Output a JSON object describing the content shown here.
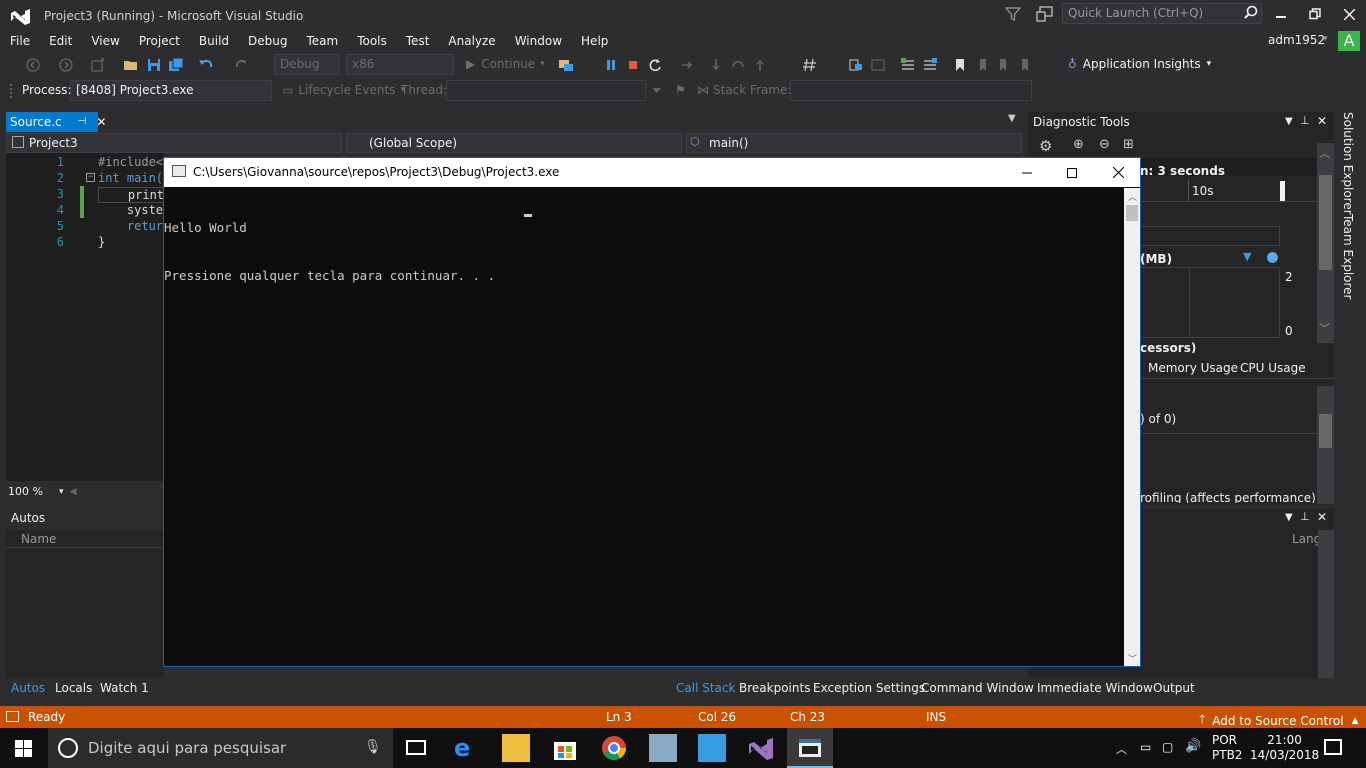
{
  "window": {
    "title": "Project3 (Running) - Microsoft Visual Studio",
    "quick_launch_placeholder": "Quick Launch (Ctrl+Q)"
  },
  "menu": [
    "File",
    "Edit",
    "View",
    "Project",
    "Build",
    "Debug",
    "Team",
    "Tools",
    "Test",
    "Analyze",
    "Window",
    "Help"
  ],
  "user": {
    "name": "adm1952",
    "avatar_letter": "A"
  },
  "toolbar": {
    "config": "Debug",
    "platform": "x86",
    "continue_label": "Continue",
    "app_insights_label": "Application Insights"
  },
  "debug_location": {
    "process_label": "Process:",
    "process_value": "[8408] Project3.exe",
    "lifecycle_label": "Lifecycle Events",
    "thread_label": "Thread:",
    "stack_frame_label": "Stack Frame:"
  },
  "editor": {
    "tab_label": "Source.c",
    "project_combo": "Project3",
    "scope_combo": "(Global Scope)",
    "member_combo": "main()",
    "lines": [
      {
        "num": "1",
        "text": "#include<"
      },
      {
        "num": "2",
        "text": "int main("
      },
      {
        "num": "3",
        "text": "    print"
      },
      {
        "num": "4",
        "text": "    syste"
      },
      {
        "num": "5",
        "text": "    retur"
      },
      {
        "num": "6",
        "text": "}"
      }
    ],
    "zoom": "100 %"
  },
  "autos": {
    "title": "Autos",
    "name_column": "Name",
    "lang_column": "Lang"
  },
  "diagnostic_tools": {
    "title": "Diagnostic Tools",
    "session_fragment": "n: 3 seconds",
    "tick_10s": "10s",
    "memory_fragment": "(MB)",
    "axis_top": "2",
    "axis_bottom": "0",
    "processors_fragment": "cessors)",
    "tab_memory": "Memory Usage",
    "tab_cpu": "CPU Usage",
    "events_fragment": ") of 0)",
    "profiling_fragment": "rofiling (affects performance)"
  },
  "side_tabs": {
    "solution_explorer": "Solution Explorer",
    "team_explorer": "Team Explorer"
  },
  "console": {
    "title": "C:\\Users\\Giovanna\\source\\repos\\Project3\\Debug\\Project3.exe",
    "output_line1": "Hello World",
    "output_line2": "Pressione qualquer tecla para continuar. . ."
  },
  "bottom_left_tabs": [
    "Autos",
    "Locals",
    "Watch 1"
  ],
  "bottom_right_tabs": [
    "Call Stack",
    "Breakpoints",
    "Exception Settings",
    "Command Window",
    "Immediate Window",
    "Output"
  ],
  "status_bar": {
    "ready": "Ready",
    "line": "Ln 3",
    "col": "Col 26",
    "ch": "Ch 23",
    "mode": "INS",
    "source_control": "Add to Source Control"
  },
  "taskbar": {
    "search_placeholder": "Digite aqui para pesquisar",
    "lang_line1": "POR",
    "lang_line2": "PTB2",
    "time": "21:00",
    "date": "14/03/2018"
  },
  "colors": {
    "accent": "#007acc",
    "statusbar": "#ca5100",
    "console_bg": "#0c0c0c"
  }
}
